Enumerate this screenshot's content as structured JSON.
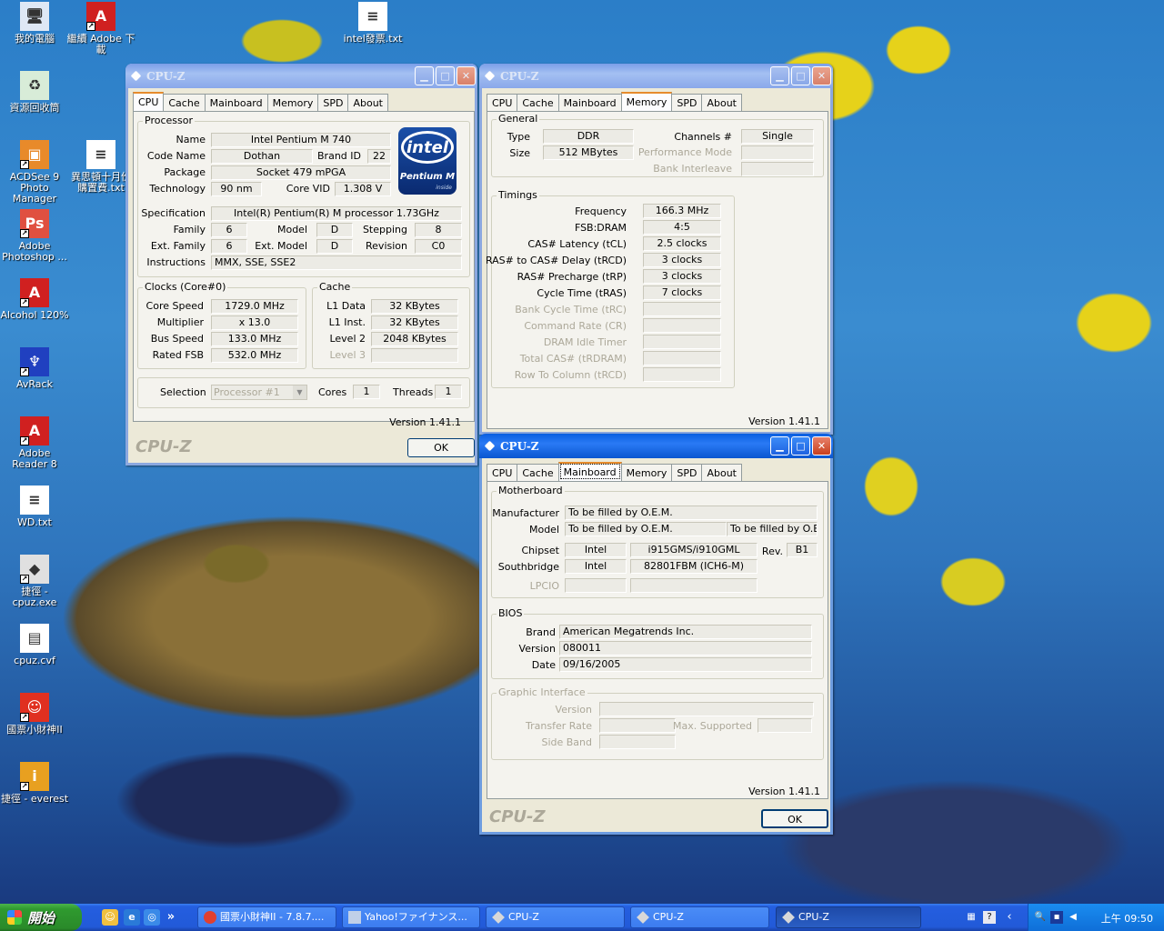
{
  "desktop": {
    "icons": [
      {
        "label": "我的電腦",
        "glyph": "🖥",
        "color": "#dfe8f5"
      },
      {
        "label": "繼續 Adobe 下載",
        "glyph": "A",
        "color": "#d02020"
      },
      {
        "label": "intel發票.txt",
        "glyph": "≡",
        "color": "#ffffff"
      },
      {
        "label": "資源回收筒",
        "glyph": "♻",
        "color": "#d8ecd8"
      },
      {
        "label": "ACDSee 9 Photo Manager",
        "glyph": "▣",
        "color": "#e88a2a"
      },
      {
        "label": "異思頓十月份購置費.txt",
        "glyph": "≡",
        "color": "#ffffff"
      },
      {
        "label": "Adobe Photoshop ...",
        "glyph": "Ps",
        "color": "#e05040"
      },
      {
        "label": "Alcohol 120%",
        "glyph": "A",
        "color": "#d02020"
      },
      {
        "label": "AvRack",
        "glyph": "♆",
        "color": "#2040c0"
      },
      {
        "label": "Adobe Reader 8",
        "glyph": "A",
        "color": "#d02020"
      },
      {
        "label": "WD.txt",
        "glyph": "≡",
        "color": "#ffffff"
      },
      {
        "label": "捷徑 - cpuz.exe",
        "glyph": "◆",
        "color": "#e0e0e0"
      },
      {
        "label": "cpuz.cvf",
        "glyph": "▤",
        "color": "#ffffff"
      },
      {
        "label": "國票小財神II",
        "glyph": "☺",
        "color": "#e03020"
      },
      {
        "label": "捷徑 - everest",
        "glyph": "i",
        "color": "#e8a020"
      }
    ]
  },
  "cpu_window": {
    "title": "CPU-Z",
    "tabs": [
      "CPU",
      "Cache",
      "Mainboard",
      "Memory",
      "SPD",
      "About"
    ],
    "selected_tab": "CPU",
    "processor": {
      "group": "Processor",
      "name_label": "Name",
      "name": "Intel Pentium M 740",
      "codename_label": "Code Name",
      "codename": "Dothan",
      "brandid_label": "Brand ID",
      "brandid": "22",
      "package_label": "Package",
      "package": "Socket 479 mPGA",
      "technology_label": "Technology",
      "technology": "90 nm",
      "corevid_label": "Core VID",
      "corevid": "1.308 V",
      "spec_label": "Specification",
      "spec": "Intel(R) Pentium(R) M processor 1.73GHz",
      "family_label": "Family",
      "family": "6",
      "model_label": "Model",
      "model": "D",
      "stepping_label": "Stepping",
      "stepping": "8",
      "extfamily_label": "Ext. Family",
      "extfamily": "6",
      "extmodel_label": "Ext. Model",
      "extmodel": "D",
      "revision_label": "Revision",
      "revision": "C0",
      "instr_label": "Instructions",
      "instructions": "MMX, SSE, SSE2",
      "logo": {
        "brand": "intel",
        "line": "Pentium M",
        "sub": "inside"
      }
    },
    "clocks": {
      "group": "Clocks (Core#0)",
      "corespeed_label": "Core Speed",
      "corespeed": "1729.0 MHz",
      "multiplier_label": "Multiplier",
      "multiplier": "x 13.0",
      "busspeed_label": "Bus Speed",
      "busspeed": "133.0 MHz",
      "ratedfsb_label": "Rated FSB",
      "ratedfsb": "532.0 MHz"
    },
    "cache": {
      "group": "Cache",
      "l1d_label": "L1 Data",
      "l1d": "32 KBytes",
      "l1i_label": "L1 Inst.",
      "l1i": "32 KBytes",
      "l2_label": "Level 2",
      "l2": "2048 KBytes",
      "l3_label": "Level 3",
      "l3": ""
    },
    "selection": {
      "label": "Selection",
      "value": "Processor #1",
      "cores_label": "Cores",
      "cores": "1",
      "threads_label": "Threads",
      "threads": "1"
    },
    "version": "Version 1.41.1",
    "logo_text": "CPU-Z",
    "ok": "OK"
  },
  "mem_window": {
    "title": "CPU-Z",
    "tabs": [
      "CPU",
      "Cache",
      "Mainboard",
      "Memory",
      "SPD",
      "About"
    ],
    "selected_tab": "Memory",
    "general": {
      "group": "General",
      "type_label": "Type",
      "type": "DDR",
      "size_label": "Size",
      "size": "512 MBytes",
      "channels_label": "Channels #",
      "channels": "Single",
      "perf_label": "Performance Mode",
      "perf": "",
      "bank_label": "Bank Interleave",
      "bank": ""
    },
    "timings": {
      "group": "Timings",
      "rows": [
        {
          "label": "Frequency",
          "value": "166.3 MHz",
          "disabled": false
        },
        {
          "label": "FSB:DRAM",
          "value": "4:5",
          "disabled": false
        },
        {
          "label": "CAS# Latency (tCL)",
          "value": "2.5 clocks",
          "disabled": false
        },
        {
          "label": "RAS# to CAS# Delay (tRCD)",
          "value": "3 clocks",
          "disabled": false
        },
        {
          "label": "RAS# Precharge (tRP)",
          "value": "3 clocks",
          "disabled": false
        },
        {
          "label": "Cycle Time (tRAS)",
          "value": "7 clocks",
          "disabled": false
        },
        {
          "label": "Bank Cycle Time (tRC)",
          "value": "",
          "disabled": true
        },
        {
          "label": "Command Rate (CR)",
          "value": "",
          "disabled": true
        },
        {
          "label": "DRAM Idle Timer",
          "value": "",
          "disabled": true
        },
        {
          "label": "Total CAS# (tRDRAM)",
          "value": "",
          "disabled": true
        },
        {
          "label": "Row To Column (tRCD)",
          "value": "",
          "disabled": true
        }
      ]
    },
    "version": "Version 1.41.1"
  },
  "mb_window": {
    "title": "CPU-Z",
    "tabs": [
      "CPU",
      "Cache",
      "Mainboard",
      "Memory",
      "SPD",
      "About"
    ],
    "selected_tab": "Mainboard",
    "motherboard": {
      "group": "Motherboard",
      "manufacturer_label": "Manufacturer",
      "manufacturer": "To be filled by O.E.M.",
      "model_label": "Model",
      "model": "To be filled by O.E.M.",
      "model2": "To be filled by O.E.M",
      "chipset_label": "Chipset",
      "chipset_vendor": "Intel",
      "chipset": "i915GMS/i910GML",
      "rev_label": "Rev.",
      "rev": "B1",
      "sb_label": "Southbridge",
      "sb_vendor": "Intel",
      "sb": "82801FBM (ICH6-M)",
      "lpcio_label": "LPCIO"
    },
    "bios": {
      "group": "BIOS",
      "brand_label": "Brand",
      "brand": "American Megatrends Inc.",
      "version_label": "Version",
      "version": "080011",
      "date_label": "Date",
      "date": "09/16/2005"
    },
    "graphic": {
      "group": "Graphic Interface",
      "version_label": "Version",
      "transfer_label": "Transfer Rate",
      "max_label": "Max. Supported",
      "sideband_label": "Side Band"
    },
    "version": "Version 1.41.1",
    "logo_text": "CPU-Z",
    "ok": "OK"
  },
  "taskbar": {
    "start": "開始",
    "quicklaunch_more": "»",
    "tasks": [
      {
        "label": "國票小財神II - 7.8.7....",
        "active": false
      },
      {
        "label": "Yahoo!ファイナンス...",
        "active": false
      },
      {
        "label": "CPU-Z",
        "active": false
      },
      {
        "label": "CPU-Z",
        "active": false
      },
      {
        "label": "CPU-Z",
        "active": true
      }
    ],
    "tray_expand": "‹",
    "clock": "上午 09:50"
  }
}
